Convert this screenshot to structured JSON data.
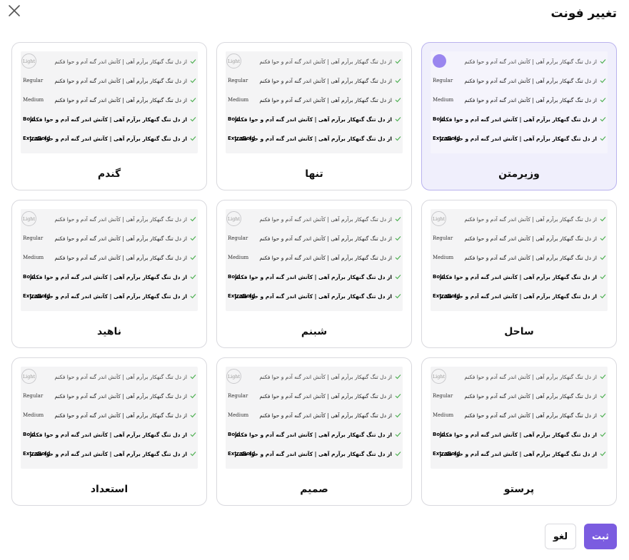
{
  "dialog": {
    "title": "تغییر فونت",
    "close_icon": "close-icon",
    "submit_label": "ثبت",
    "cancel_label": "لغو"
  },
  "colors": {
    "accent": "#7b5ce0",
    "selected_card_bg": "#f0effc",
    "selected_dot": "#9a86ef",
    "check": "#4caf50"
  },
  "preview": {
    "sample_text": "از دل تنگ گنهکار برآرم آهی | کآتش اندر گنه آدم و حوا فکنم",
    "weights": [
      "Light",
      "Regular",
      "Medium",
      "Bold",
      "ExtraBold"
    ]
  },
  "fonts": [
    {
      "name": "وزیرمتن",
      "selected": true
    },
    {
      "name": "تنها",
      "selected": false
    },
    {
      "name": "گندم",
      "selected": false
    },
    {
      "name": "ساحل",
      "selected": false
    },
    {
      "name": "شبنم",
      "selected": false
    },
    {
      "name": "ناهید",
      "selected": false
    },
    {
      "name": "پرستو",
      "selected": false
    },
    {
      "name": "صمیم",
      "selected": false
    },
    {
      "name": "استعداد",
      "selected": false
    }
  ]
}
